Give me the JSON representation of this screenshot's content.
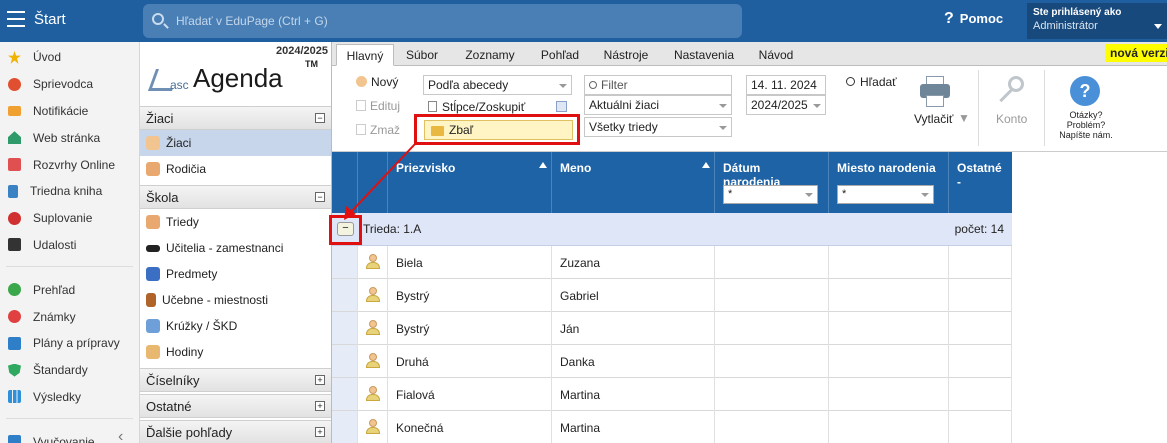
{
  "topbar": {
    "start_label": "Štart",
    "search_placeholder": "Hľadať v EduPage (Ctrl + G)",
    "help_label": "Pomoc",
    "user_line1": "Ste prihlásený ako",
    "user_line2": "Administrátor"
  },
  "leftnav": {
    "items": [
      {
        "label": "Úvod",
        "icon": "star-icon",
        "color": "#f0b400"
      },
      {
        "label": "Sprievodca",
        "icon": "compass-icon",
        "color": "#e05030"
      },
      {
        "label": "Notifikácie",
        "icon": "mail-icon",
        "color": "#f0a030"
      },
      {
        "label": "Web stránka",
        "icon": "home-icon",
        "color": "#2f9a6a"
      },
      {
        "label": "Rozvrhy Online",
        "icon": "calendar-icon",
        "color": "#e05050"
      },
      {
        "label": "Triedna kniha",
        "icon": "book-icon",
        "color": "#3b82c4"
      },
      {
        "label": "Suplovanie",
        "icon": "substitute-icon",
        "color": "#d03030"
      },
      {
        "label": "Udalosti",
        "icon": "events-icon",
        "color": "#333333"
      },
      {
        "label": "Prehľad",
        "icon": "check-icon",
        "color": "#3aa84a"
      },
      {
        "label": "Známky",
        "icon": "grades-icon",
        "color": "#e04040"
      },
      {
        "label": "Plány a prípravy",
        "icon": "briefcase-icon",
        "color": "#2f7fc8"
      },
      {
        "label": "Štandardy",
        "icon": "shield-icon",
        "color": "#2fa860"
      },
      {
        "label": "Výsledky",
        "icon": "chart-icon",
        "color": "#2f8fd8"
      },
      {
        "label": "Vyučovanie",
        "icon": "teaching-icon",
        "color": "#2f7fc8"
      }
    ]
  },
  "agenda": {
    "year": "2024/2025",
    "logo_asc": "asc",
    "logo_agenda": "Agenda",
    "logo_tm": "TM",
    "sections": [
      {
        "label": "Žiaci",
        "toggle": "−"
      },
      {
        "label": "Škola",
        "toggle": "−"
      },
      {
        "label": "Číselníky",
        "toggle": "+"
      },
      {
        "label": "Ostatné",
        "toggle": "+"
      },
      {
        "label": "Ďalšie pohľady",
        "toggle": "+"
      }
    ],
    "zaci_items": [
      {
        "label": "Žiaci",
        "icon": "student-icon"
      },
      {
        "label": "Rodičia",
        "icon": "parents-icon"
      }
    ],
    "skola_items": [
      {
        "label": "Triedy",
        "icon": "class-icon"
      },
      {
        "label": "Učitelia - zamestnanci",
        "icon": "teacher-icon"
      },
      {
        "label": "Predmety",
        "icon": "subject-icon"
      },
      {
        "label": "Učebne - miestnosti",
        "icon": "room-icon"
      },
      {
        "label": "Krúžky / ŠKD",
        "icon": "club-icon"
      },
      {
        "label": "Hodiny",
        "icon": "hours-icon"
      }
    ]
  },
  "tabs": [
    "Hlavný",
    "Súbor",
    "Zoznamy",
    "Pohľad",
    "Nástroje",
    "Nastavenia",
    "Návod"
  ],
  "new_version": "nová verzia",
  "toolbar": {
    "new_label": "Nový",
    "edit_label": "Edituj",
    "delete_label": "Zmaž",
    "sort_value": "Podľa abecedy",
    "columns_label": "Stĺpce/Zoskupiť",
    "collapse_label": "Zbaľ",
    "filter_placeholder": "Filter",
    "students_value": "Aktuálni žiaci",
    "classes_value": "Všetky triedy",
    "date_value": "14. 11. 2024",
    "year_value": "2024/2025",
    "find_label": "Hľadať",
    "print_label": "Vytlačiť",
    "account_label": "Konto",
    "questions_line1": "Otázky?",
    "questions_line2": "Problém?",
    "questions_line3": "Napíšte nám."
  },
  "grid": {
    "columns": [
      "Priezvisko",
      "Meno",
      "Dátum narodenia",
      "Miesto narodenia",
      "Ostatné -"
    ],
    "filter_value": "*",
    "group": {
      "label": "Trieda: 1.A",
      "count": "počet: 14",
      "toggle": "−"
    },
    "rows": [
      {
        "surname": "Biela",
        "name": "Zuzana"
      },
      {
        "surname": "Bystrý",
        "name": "Gabriel"
      },
      {
        "surname": "Bystrý",
        "name": "Ján"
      },
      {
        "surname": "Druhá",
        "name": "Danka"
      },
      {
        "surname": "Fialová",
        "name": "Martina"
      },
      {
        "surname": "Konečná",
        "name": "Martina"
      }
    ]
  }
}
